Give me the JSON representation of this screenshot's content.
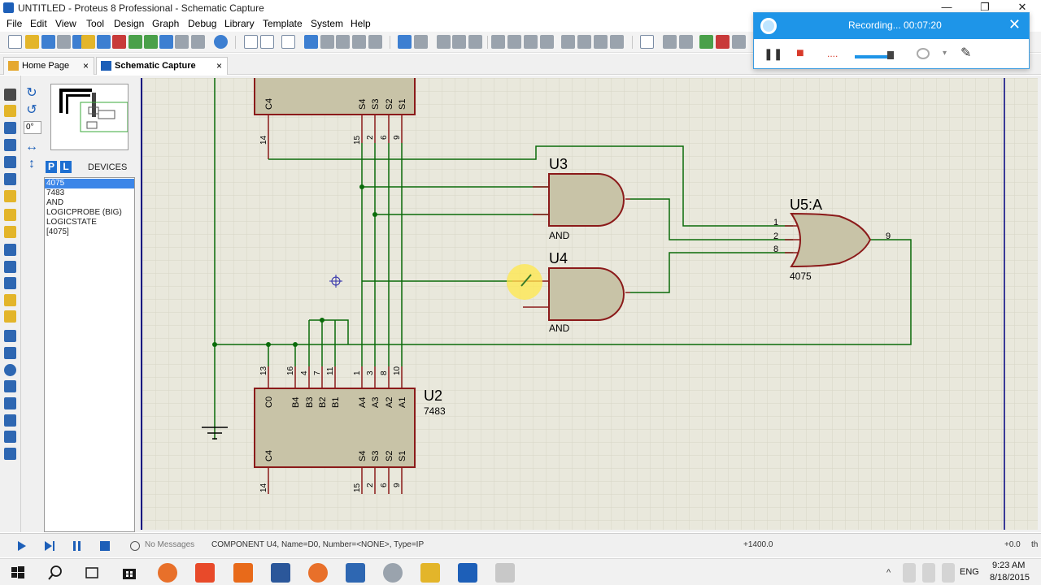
{
  "window": {
    "title": "UNTITLED - Proteus 8 Professional - Schematic Capture",
    "minimize": "—",
    "maximize": "❐",
    "close": "✕"
  },
  "menu": [
    "File",
    "Edit",
    "View",
    "Tool",
    "Design",
    "Graph",
    "Debug",
    "Library",
    "Template",
    "System",
    "Help"
  ],
  "tabs": [
    {
      "label": "Home Page",
      "close": "×",
      "active": false
    },
    {
      "label": "Schematic Capture",
      "close": "×",
      "active": true
    }
  ],
  "left_panel": {
    "angle": "0°",
    "p_button": "P",
    "l_button": "L",
    "devices_title": "DEVICES",
    "devices": [
      "4075",
      "7483",
      "AND",
      "LOGICPROBE (BIG)",
      "LOGICSTATE",
      "[4075]"
    ],
    "selected_device": "4075"
  },
  "recorder": {
    "status": "Recording... 00:07:20",
    "close": "✕",
    "pause": "❚❚",
    "stop": "■",
    "dots": "....",
    "dropdown": "▾",
    "pen": "✎"
  },
  "schematic": {
    "u3": {
      "ref": "U3",
      "type": "AND"
    },
    "u4": {
      "ref": "U4",
      "type": "AND"
    },
    "u5": {
      "ref": "U5:A",
      "type": "4075",
      "pins": [
        "1",
        "2",
        "8"
      ],
      "out": "9"
    },
    "u2": {
      "ref": "U2",
      "type": "7483",
      "top_labels": [
        "C0",
        "B4",
        "B3",
        "B2",
        "B1",
        "A4",
        "A3",
        "A2",
        "A1"
      ],
      "top_pins": [
        "13",
        "16",
        "4",
        "7",
        "11",
        "1",
        "3",
        "8",
        "10"
      ],
      "bottom_labels": [
        "C4",
        "S4",
        "S3",
        "S2",
        "S1"
      ],
      "bottom_pins": [
        "14",
        "15",
        "2",
        "6",
        "9"
      ]
    },
    "u1_partial": {
      "bottom_labels": [
        "C4",
        "S4",
        "S3",
        "S2",
        "S1"
      ],
      "bottom_pins": [
        "14",
        "15",
        "2",
        "6",
        "9"
      ]
    }
  },
  "status_bar": {
    "messages": "No Messages",
    "text": "COMPONENT U4, Name=D0, Number=<NONE>, Type=IP",
    "x": "+1400.0",
    "y": "+0.0",
    "unit": "th"
  },
  "taskbar": {
    "language": "ENG",
    "time": "9:23 AM",
    "date": "8/18/2015"
  }
}
